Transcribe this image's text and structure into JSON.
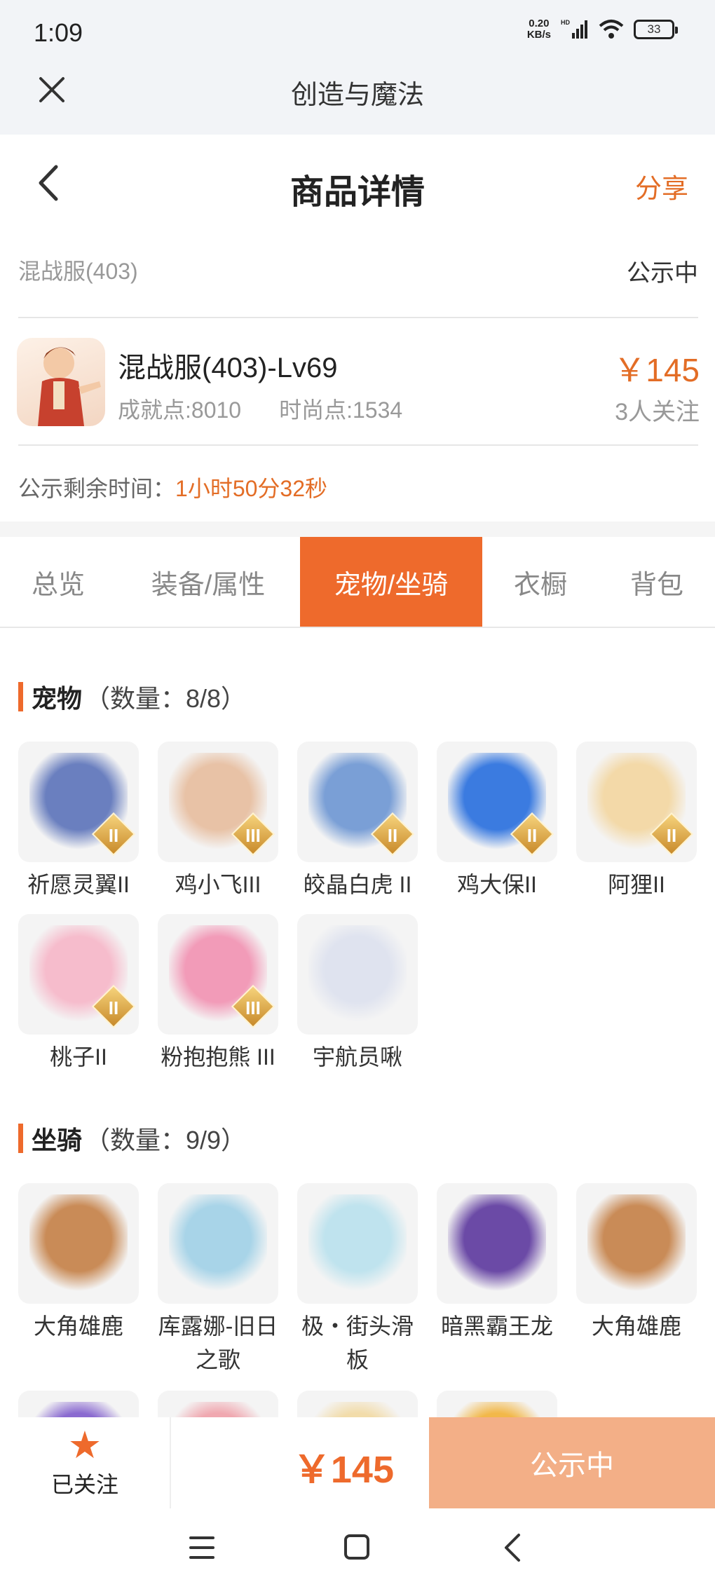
{
  "status_bar": {
    "time": "1:09",
    "speed_value": "0.20",
    "speed_unit": "KB/s",
    "net_type": "HD",
    "battery": "33"
  },
  "app_bar": {
    "title": "创造与魔法"
  },
  "header": {
    "title": "商品详情",
    "share_label": "分享"
  },
  "server": {
    "name": "混战服(403)",
    "status": "公示中"
  },
  "item": {
    "name": "混战服(403)-Lv69",
    "achievement": "成就点:8010",
    "fashion": "时尚点:1534",
    "price": "￥145",
    "followers": "3人关注"
  },
  "countdown": {
    "label": "公示剩余时间：",
    "time": "1小时50分32秒"
  },
  "tabs": [
    {
      "label": "总览"
    },
    {
      "label": "装备/属性"
    },
    {
      "label": "宠物/坐骑",
      "active": true
    },
    {
      "label": "衣橱"
    },
    {
      "label": "背包"
    }
  ],
  "pets": {
    "title": "宠物",
    "count": "（数量：8/8）",
    "items": [
      {
        "name": "祈愿灵翼II",
        "badge": "II",
        "color": "#6a7fbf"
      },
      {
        "name": "鸡小飞III",
        "badge": "III",
        "color": "#e8c2a6"
      },
      {
        "name": "皎晶白虎 II",
        "badge": "II",
        "color": "#7a9fd6"
      },
      {
        "name": "鸡大保II",
        "badge": "II",
        "color": "#3b7be0"
      },
      {
        "name": "阿狸II",
        "badge": "II",
        "color": "#f3d9a8"
      },
      {
        "name": "桃子II",
        "badge": "II",
        "color": "#f6bccc"
      },
      {
        "name": "粉抱抱熊 III",
        "badge": "III",
        "color": "#f29bb8"
      },
      {
        "name": "宇航员啾",
        "badge": "",
        "color": "#dfe3ef"
      }
    ]
  },
  "mounts": {
    "title": "坐骑",
    "count": "（数量：9/9）",
    "items": [
      {
        "name": "大角雄鹿",
        "color": "#c98b57"
      },
      {
        "name": "库露娜-旧日之歌",
        "color": "#a8d4e8"
      },
      {
        "name": "极・街头滑板",
        "color": "#bfe3ee"
      },
      {
        "name": "暗黑霸王龙",
        "color": "#6b4aa6"
      },
      {
        "name": "大角雄鹿",
        "color": "#c98b57"
      },
      {
        "name": "",
        "color": "#8a6ad0"
      },
      {
        "name": "",
        "color": "#f0a8b0"
      },
      {
        "name": "",
        "color": "#f2dcaa"
      },
      {
        "name": "",
        "color": "#f2b84a"
      }
    ]
  },
  "bottom": {
    "follow_label": "已关注",
    "price": "￥145",
    "button_label": "公示中"
  },
  "colors": {
    "accent": "#ee6a2c",
    "button": "#f3af87"
  }
}
